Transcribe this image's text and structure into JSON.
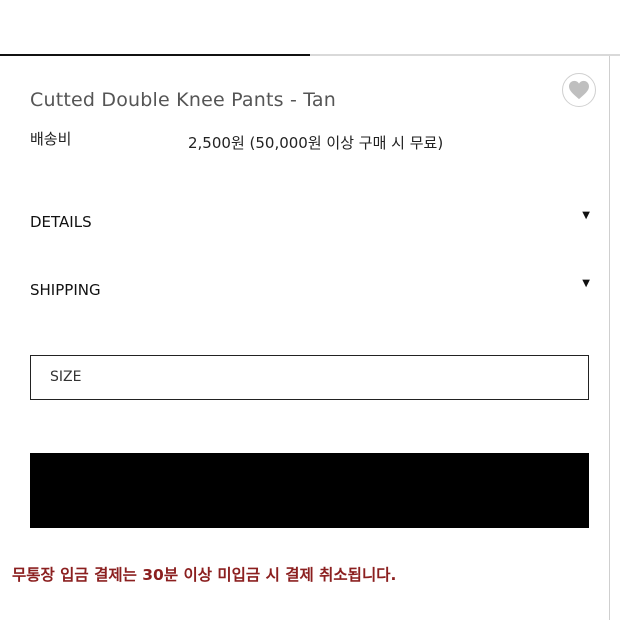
{
  "product": {
    "title": "Cutted Double Knee Pants - Tan"
  },
  "shipping_fee": {
    "label": "배송비",
    "value": "2,500원 (50,000원 이상 구매 시 무료)"
  },
  "accordion": {
    "details_label": "DETAILS",
    "shipping_label": "SHIPPING",
    "caret": "▼"
  },
  "size_select": {
    "label": "SIZE"
  },
  "notice": {
    "text": "무통장 입금 결제는 30분 이상 미입금 시 결제 취소됩니다."
  },
  "top_progress": {
    "fraction": 0.5
  },
  "colors": {
    "accent": "#000000",
    "notice": "#8b1f1f",
    "title": "#555555"
  },
  "icons": {
    "wishlist": "heart-icon",
    "expand": "caret-down-icon"
  }
}
